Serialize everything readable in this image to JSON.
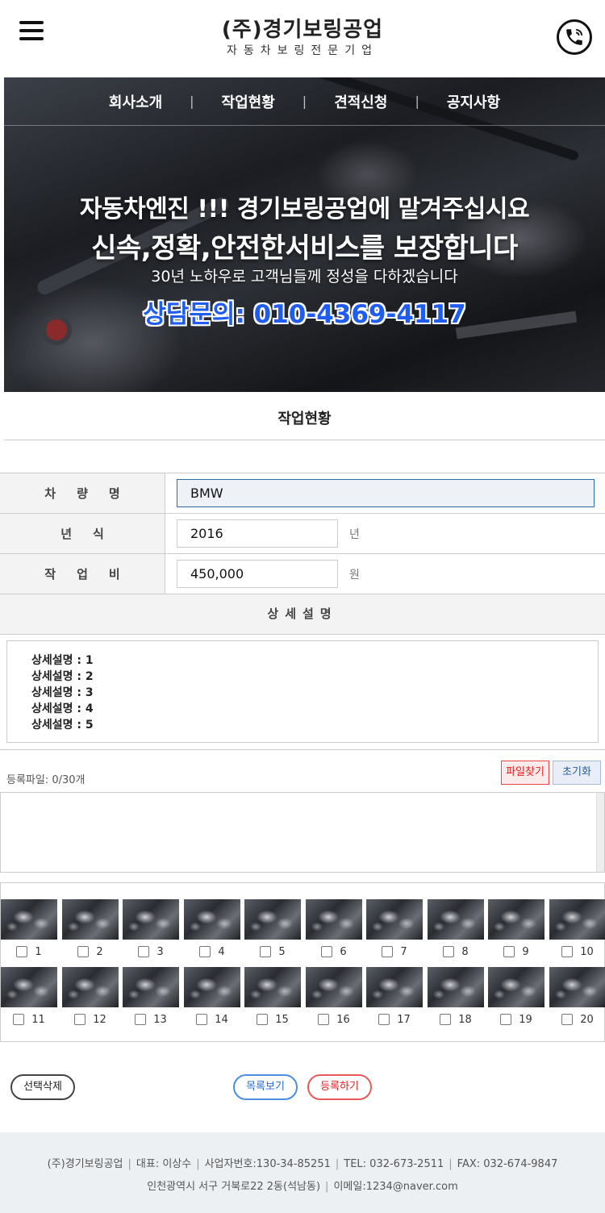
{
  "header": {
    "logo_main": "(주)경기보링공업",
    "logo_sub": "자동차보링전문기업",
    "menu_icon": "hamburger-menu-icon",
    "phone_icon": "phone-call-icon"
  },
  "hero": {
    "nav": [
      "회사소개",
      "작업현황",
      "견적신청",
      "공지사항"
    ],
    "line1": "자동차엔진 !!! 경기보링공업에 맡겨주십시요",
    "line2": "신속,정확,안전한서비스를 보장합니다",
    "line3": "30년 노하우로 고객님들께 정성을 다하겠습니다",
    "contact": "상담문의: 010-4369-4117"
  },
  "section_title": "작업현황",
  "form": {
    "vehicle_label": "차량명",
    "vehicle_value": "BMW",
    "year_label": "년식",
    "year_value": "2016",
    "year_unit": "년",
    "cost_label": "작업비",
    "cost_value": "450,000",
    "cost_unit": "원",
    "detail_label": "상세설명",
    "details": [
      "상세설명 : 1",
      "상세설명 : 2",
      "상세설명 : 3",
      "상세설명 : 4",
      "상세설명 : 5"
    ]
  },
  "upload": {
    "count_text": "등록파일: 0/30개",
    "find_label": "파일찾기",
    "reset_label": "초기화"
  },
  "thumbnails": [
    "1",
    "2",
    "3",
    "4",
    "5",
    "6",
    "7",
    "8",
    "9",
    "10",
    "11",
    "12",
    "13",
    "14",
    "15",
    "16",
    "17",
    "18",
    "19",
    "20"
  ],
  "buttons": {
    "delete_label": "선택삭제",
    "list_label": "목록보기",
    "register_label": "등록하기"
  },
  "footer": {
    "company": "(주)경기보링공업",
    "ceo": "대표: 이상수",
    "bizno": "사업자번호:130-34-85251",
    "tel": "TEL: 032-673-2511",
    "fax": "FAX: 032-674-9847",
    "address": "인천광역시 서구 거북로22 2동(석남동)",
    "email": "이메일:1234@naver.com"
  },
  "colors": {
    "accent_blue": "#1f5cf0",
    "accent_red": "#e02020",
    "footer_bg": "#edf0f3"
  }
}
